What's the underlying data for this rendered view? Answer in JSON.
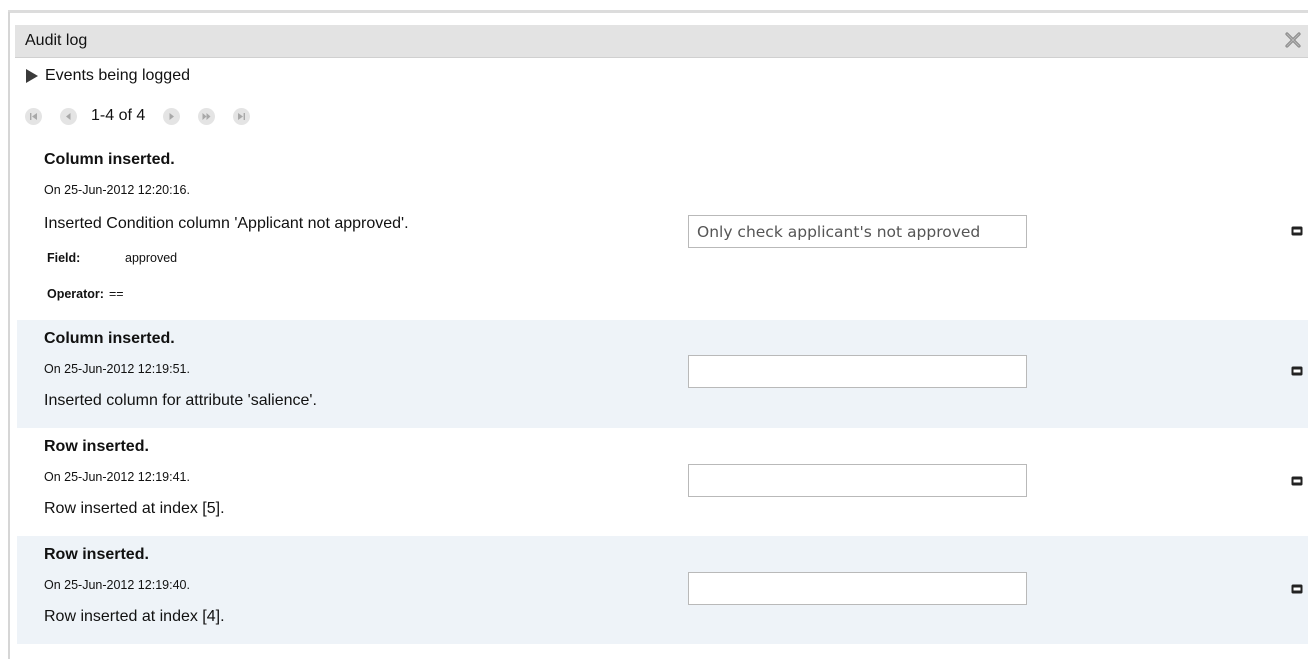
{
  "window": {
    "title": "Audit log"
  },
  "events_toggle": {
    "label": "Events being logged"
  },
  "pager": {
    "range_text": "1-4 of 4"
  },
  "entries": [
    {
      "title": "Column inserted.",
      "date": "On 25-Jun-2012 12:20:16.",
      "description": "Inserted Condition column 'Applicant not approved'.",
      "details": [
        {
          "label": "Field:",
          "value": "approved"
        },
        {
          "label": "Operator:",
          "value": "=="
        }
      ],
      "comment": "Only check applicant's not approved"
    },
    {
      "title": "Column inserted.",
      "date": "On 25-Jun-2012 12:19:51.",
      "description": "Inserted column for attribute 'salience'.",
      "details": [],
      "comment": ""
    },
    {
      "title": "Row inserted.",
      "date": "On 25-Jun-2012 12:19:41.",
      "description": "Row inserted at index [5].",
      "details": [],
      "comment": ""
    },
    {
      "title": "Row inserted.",
      "date": "On 25-Jun-2012 12:19:40.",
      "description": "Row inserted at index [4].",
      "details": [],
      "comment": ""
    }
  ],
  "colors": {
    "titlebar_bg": "#e3e3e3",
    "row_shade": "#eef3f8",
    "pager_button_bg": "#e4e4e4"
  }
}
